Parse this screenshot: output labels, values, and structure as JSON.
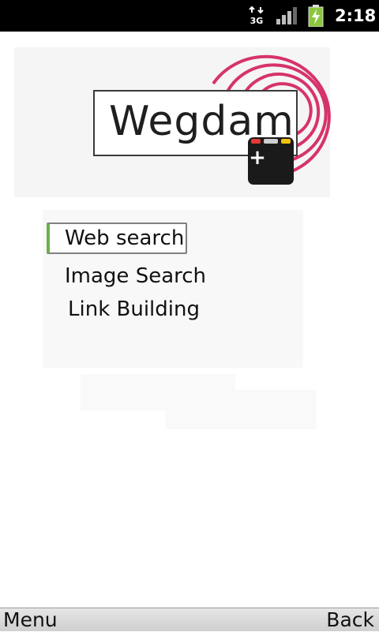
{
  "status_bar": {
    "network_label": "3G",
    "network_icon": "network-3g-icon",
    "signal_icon": "signal-strength-icon",
    "battery_icon": "battery-charging-icon",
    "time": "2:18"
  },
  "logo": {
    "text": "Wegdam",
    "badge_symbol": "+",
    "ring_color": "#d6336c",
    "badge_color": "#1a1a1a"
  },
  "menu": {
    "items": [
      {
        "label": "Web search",
        "selected": true
      },
      {
        "label": "Image Search",
        "selected": false
      },
      {
        "label": "Link Building",
        "selected": false
      }
    ],
    "focus_color": "#6ab04c"
  },
  "softkeys": {
    "left": "Menu",
    "right": "Back"
  }
}
